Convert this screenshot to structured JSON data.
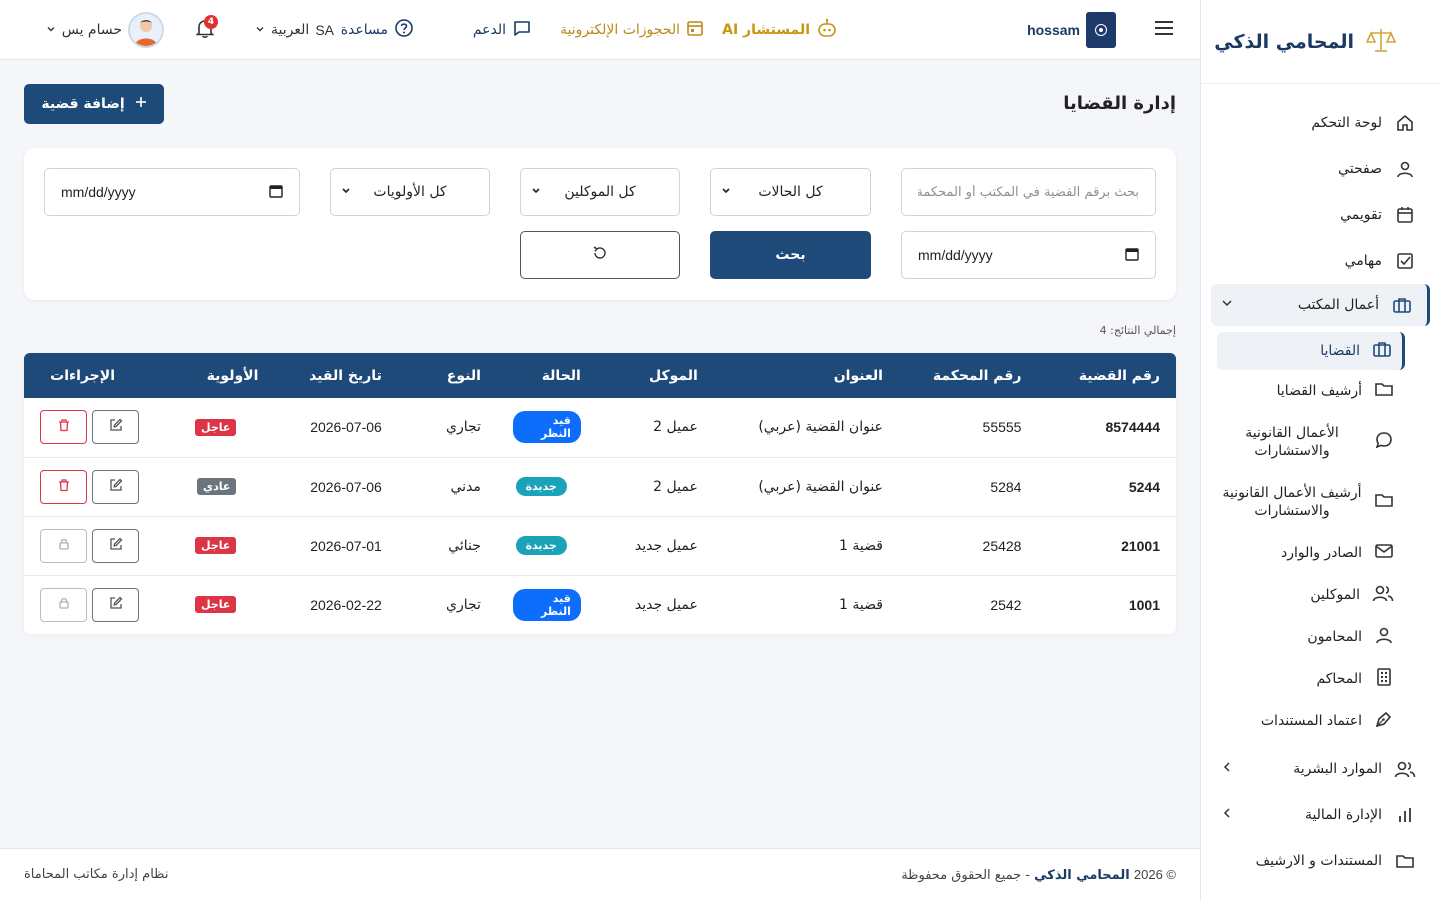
{
  "brand": {
    "title": "المحامي الذكي"
  },
  "sidebar": {
    "items": [
      {
        "label": "لوحة التحكم"
      },
      {
        "label": "صفحتي"
      },
      {
        "label": "تقويمي"
      },
      {
        "label": "مهامي"
      },
      {
        "label": "أعمال المكتب"
      }
    ],
    "sub_items": [
      {
        "label": "القضايا"
      },
      {
        "label": "أرشيف القضايا"
      },
      {
        "label": "الأعمال القانونية والاستشارات"
      },
      {
        "label": "أرشيف الأعمال القانونية والاستشارات"
      },
      {
        "label": "الصادر والوارد"
      },
      {
        "label": "الموكلين"
      },
      {
        "label": "المحامون"
      },
      {
        "label": "المحاكم"
      },
      {
        "label": "اعتماد المستندات"
      }
    ],
    "bottom_items": [
      {
        "label": "الموارد البشرية"
      },
      {
        "label": "الإدارة المالية"
      },
      {
        "label": "المستندات و الارشيف"
      }
    ]
  },
  "topbar": {
    "org_name": "hossam",
    "ai_label": "المستشار AI",
    "booking_label": "الحجوزات الإلكترونية",
    "support_label": "الدعم",
    "help_label": "مساعدة",
    "lang_label": "العربية",
    "lang_code": "SA",
    "notif_count": "4",
    "user_name": "حسام يس"
  },
  "page": {
    "title": "إدارة القضايا",
    "add_button": "إضافة قضية",
    "results_label": "إجمالي النتائج: 4"
  },
  "filters": {
    "search_placeholder": "بحث برقم القضية في المكتب أو المحكمة",
    "status_value": "كل الحالات",
    "client_value": "كل الموكلين",
    "priority_value": "كل الأولويات",
    "date_from": "mm/dd/yyyy",
    "date_to": "mm/dd/yyyy",
    "search_button": "بحث"
  },
  "table": {
    "headers": [
      "رقم القضية",
      "رقم المحكمة",
      "العنوان",
      "الموكل",
      "الحالة",
      "النوع",
      "تاريخ القيد",
      "الأولوية",
      "الإجراءات"
    ],
    "rows": [
      {
        "case_no": "8574444",
        "court_no": "55555",
        "title": "عنوان القضية (عربي)",
        "client": "عميل 2",
        "status": "قيد النظر",
        "type": "تجاري",
        "date": "2026-07-06",
        "priority": "عاجل"
      },
      {
        "case_no": "5244",
        "court_no": "5284",
        "title": "عنوان القضية (عربي)",
        "client": "عميل 2",
        "status": "جديدة",
        "type": "مدني",
        "date": "2026-07-06",
        "priority": "عادي"
      },
      {
        "case_no": "21001",
        "court_no": "25428",
        "title": "قضية 1",
        "client": "عميل جديد",
        "status": "جديدة",
        "type": "جنائي",
        "date": "2026-07-01",
        "priority": "عاجل"
      },
      {
        "case_no": "1001",
        "court_no": "2542",
        "title": "قضية 1",
        "client": "عميل جديد",
        "status": "قيد النظر",
        "type": "تجاري",
        "date": "2026-02-22",
        "priority": "عاجل"
      }
    ]
  },
  "footer": {
    "copyright_prefix": "© 2026",
    "brand": "المحامي الذكي",
    "rights": "- جميع الحقوق محفوظة",
    "system": "نظام إدارة مكاتب المحاماة"
  },
  "colors": {
    "primary": "#1e4a7a",
    "accent_gold": "#c79612",
    "danger": "#dc3545",
    "info": "#0d6efd",
    "teal": "#1aa2b8"
  }
}
